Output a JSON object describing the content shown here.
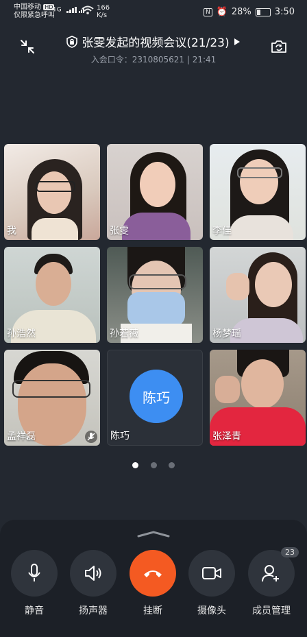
{
  "status_bar": {
    "carrier": "中国移动",
    "carrier_badge": "HD",
    "emergency": "仅限紧急呼叫",
    "network": "4G",
    "speed_value": "166",
    "speed_unit": "K/s",
    "battery": "28%",
    "time": "3:50"
  },
  "header": {
    "title": "张雯发起的视频会议(21/23)",
    "subtitle": "入会口令：2310805621 | 21:41"
  },
  "participants": [
    {
      "name": "我"
    },
    {
      "name": "张雯"
    },
    {
      "name": "李佳"
    },
    {
      "name": "孙浩然"
    },
    {
      "name": "孙若薇"
    },
    {
      "name": "杨梦瑶"
    },
    {
      "name": "孟祥磊"
    },
    {
      "name": "陈巧",
      "avatar_text": "陈巧"
    },
    {
      "name": "张泽青"
    }
  ],
  "pager": {
    "count": 3,
    "active": 0
  },
  "controls": {
    "mute": "静音",
    "speaker": "扬声器",
    "hangup": "挂断",
    "camera": "摄像头",
    "members": "成员管理",
    "members_count": "23"
  },
  "colors": {
    "background": "#232830",
    "hangup": "#f45a22",
    "avatar": "#3d8ef2"
  }
}
